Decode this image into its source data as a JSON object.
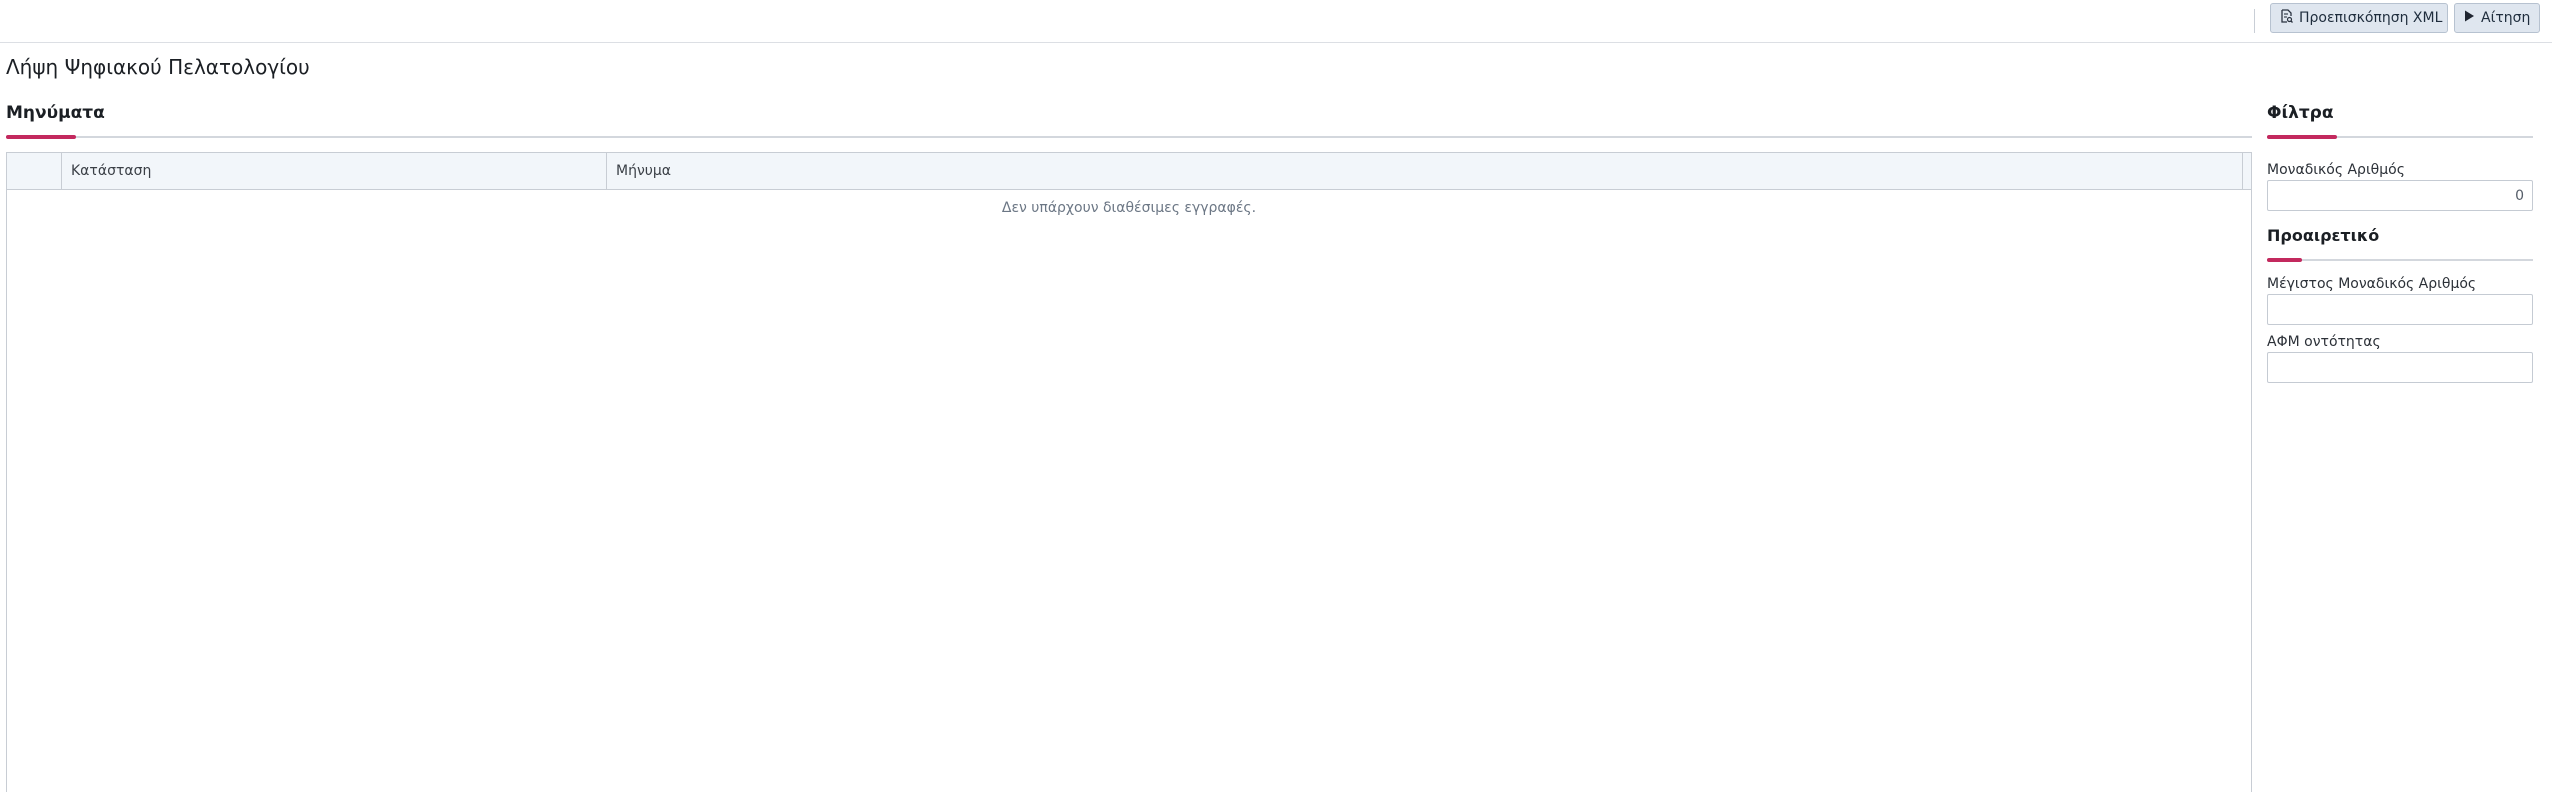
{
  "toolbar": {
    "preview_label": "Προεπισκόπηση XML",
    "preview_icon": "xml-preview-icon",
    "request_label": "Αίτηση",
    "request_icon": "play-icon"
  },
  "page": {
    "title": "Λήψη Ψηφιακού Πελατολογίου"
  },
  "messages": {
    "section_title": "Μηνύματα",
    "columns": [
      "",
      "Κατάσταση",
      "Μήνυμα"
    ],
    "rows": [],
    "empty_text": "Δεν υπάρχουν διαθέσιμες εγγραφές."
  },
  "filters": {
    "section_title": "Φίλτρα",
    "unique_number_label": "Μοναδικός Αριθμός",
    "unique_number_value": "0",
    "optional_title": "Προαιρετικό",
    "max_unique_number_label": "Μέγιστος Μοναδικός Αριθμός",
    "max_unique_number_value": "",
    "entity_vat_label": "ΑΦΜ οντότητας",
    "entity_vat_value": ""
  },
  "colors": {
    "accent": "#c3295e",
    "toolbar_button_bg": "#dfe6ef",
    "grid_header_bg": "#f2f6fa"
  }
}
